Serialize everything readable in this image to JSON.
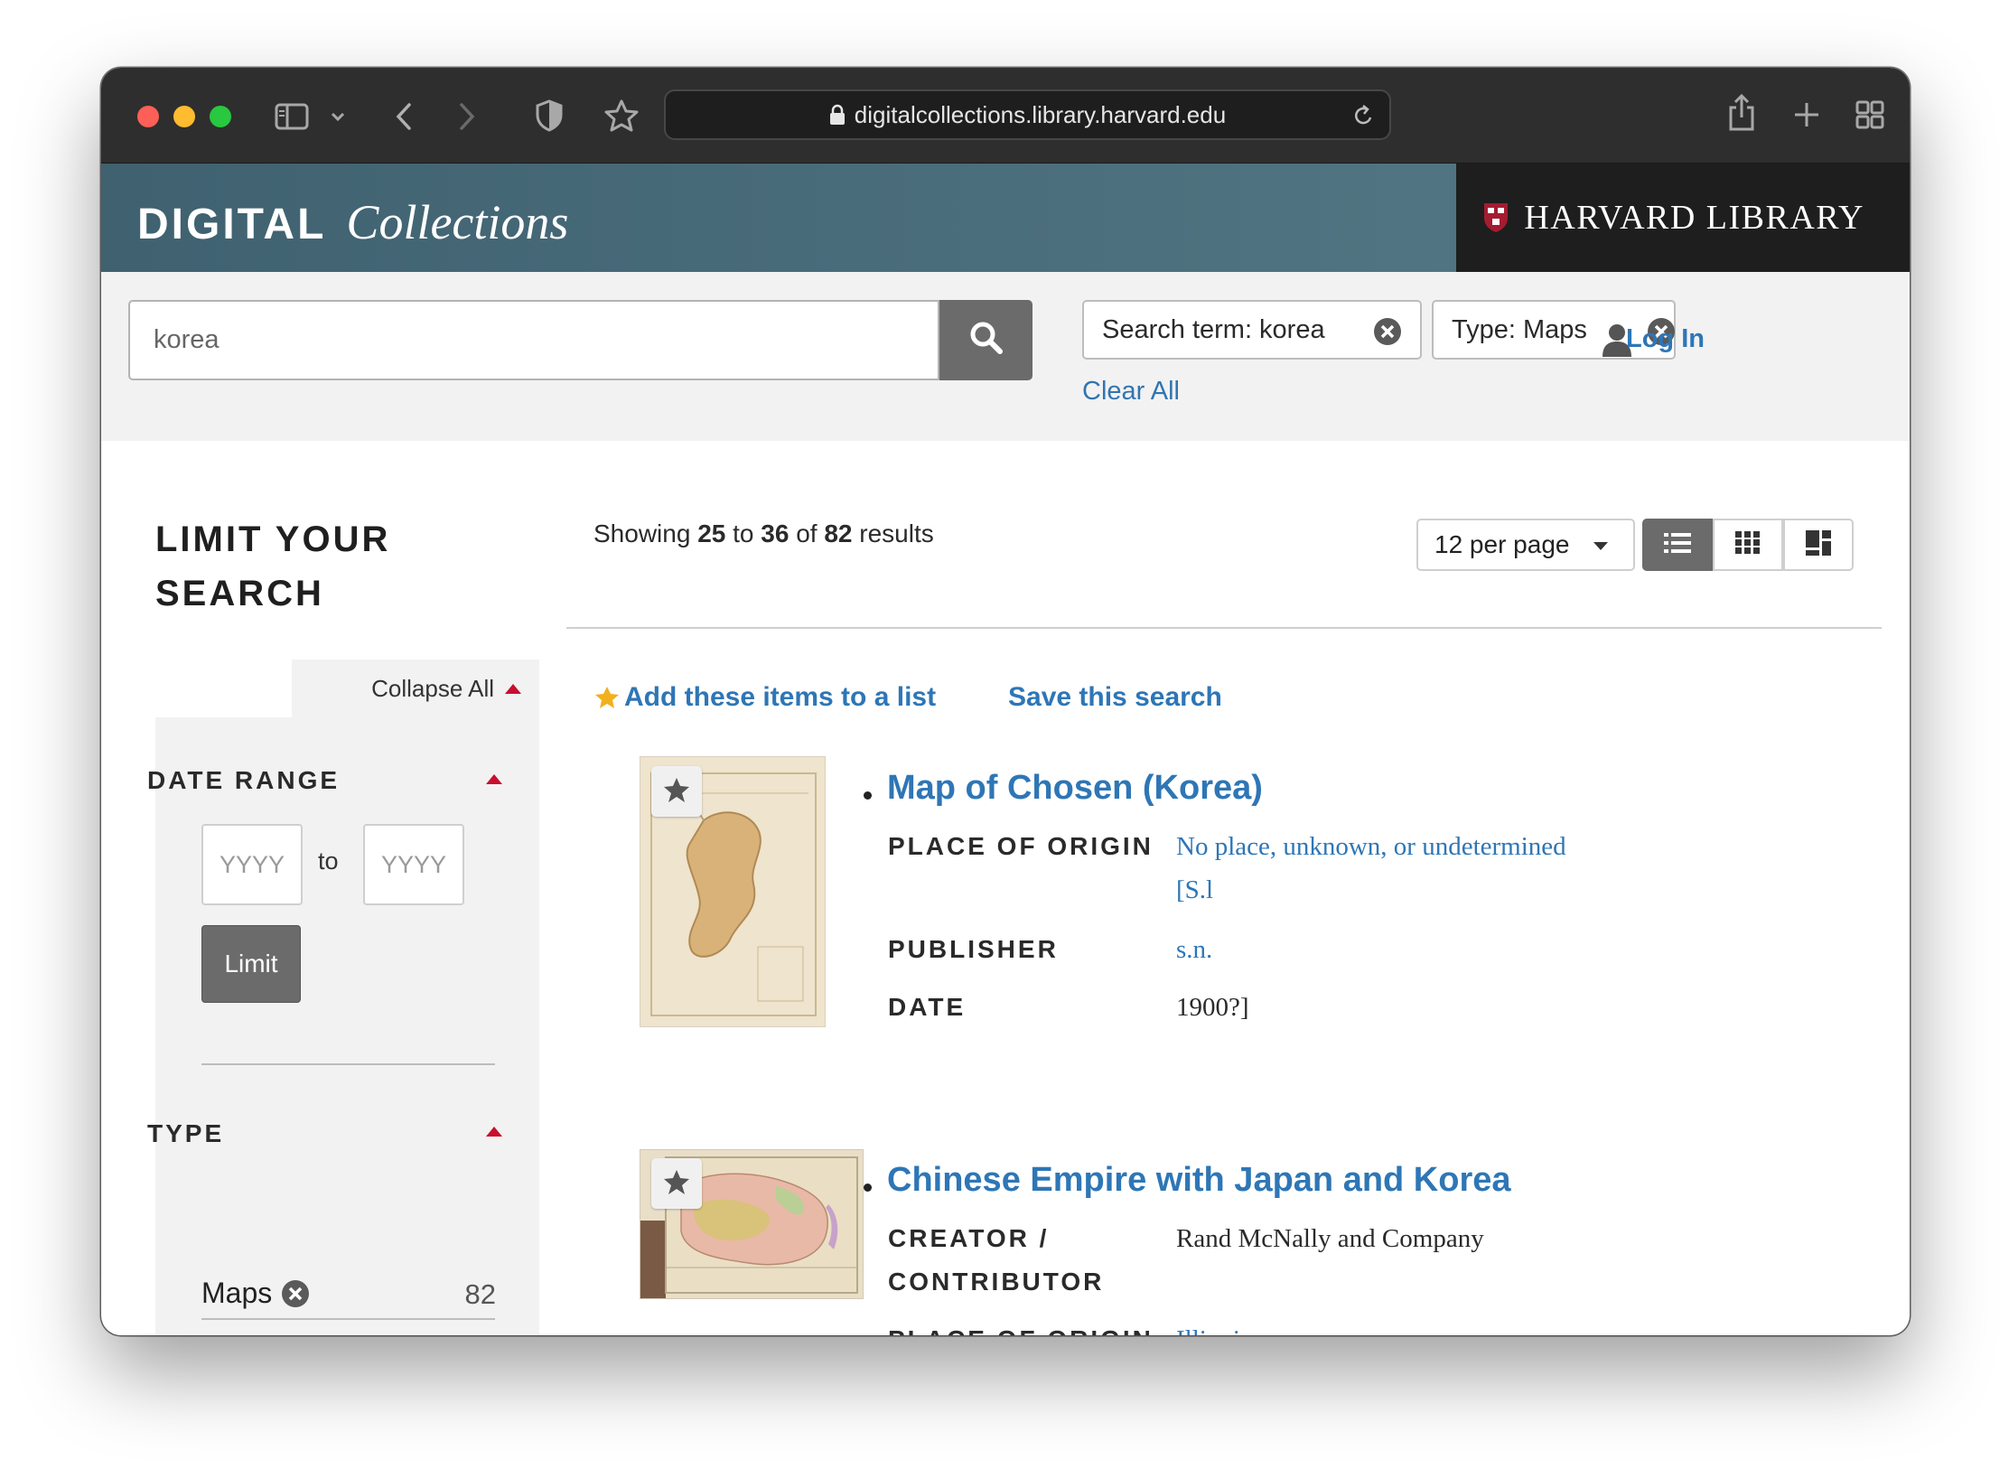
{
  "browser": {
    "url": "digitalcollections.library.harvard.edu"
  },
  "site": {
    "brand_bold": "DIGITAL",
    "brand_italic": "Collections",
    "library": "HARVARD LIBRARY"
  },
  "search": {
    "query": "korea",
    "chips": [
      {
        "label": "Search term: korea"
      },
      {
        "label": "Type: Maps"
      }
    ],
    "clear_all": "Clear All",
    "login": "Log In"
  },
  "sidebar": {
    "title": "LIMIT YOUR SEARCH",
    "collapse_all": "Collapse All",
    "date_range": {
      "heading": "DATE RANGE",
      "from_placeholder": "YYYY",
      "to_label": "to",
      "to_placeholder": "YYYY",
      "limit_button": "Limit"
    },
    "type": {
      "heading": "TYPE",
      "item_label": "Maps",
      "item_count": "82"
    }
  },
  "results": {
    "showing_prefix": "Showing",
    "range_start": "25",
    "to": "to",
    "range_end": "36",
    "of": "of",
    "total": "82",
    "suffix": "results",
    "per_page": "12 per page",
    "add_to_list": "Add these items to a list",
    "save_search": "Save this search",
    "items": [
      {
        "title": "Map of Chosen (Korea)",
        "fields": [
          {
            "label": "PLACE OF ORIGIN",
            "value": "No place, unknown, or undetermined",
            "value2": "[S.l"
          },
          {
            "label": "PUBLISHER",
            "value": "s.n."
          },
          {
            "label": "DATE",
            "value": "1900?]"
          }
        ]
      },
      {
        "title": "Chinese Empire with Japan and Korea",
        "fields": [
          {
            "label": "CREATOR /",
            "label2": "CONTRIBUTOR",
            "value": "Rand McNally and Company"
          },
          {
            "label": "PLACE OF ORIGIN",
            "value": "Illinois"
          }
        ]
      }
    ]
  },
  "colors": {
    "link": "#2e76b6",
    "header_start": "#3f6170",
    "header_end": "#577b88",
    "accent_red": "#c8102e",
    "button_gray": "#6b6b6b"
  }
}
